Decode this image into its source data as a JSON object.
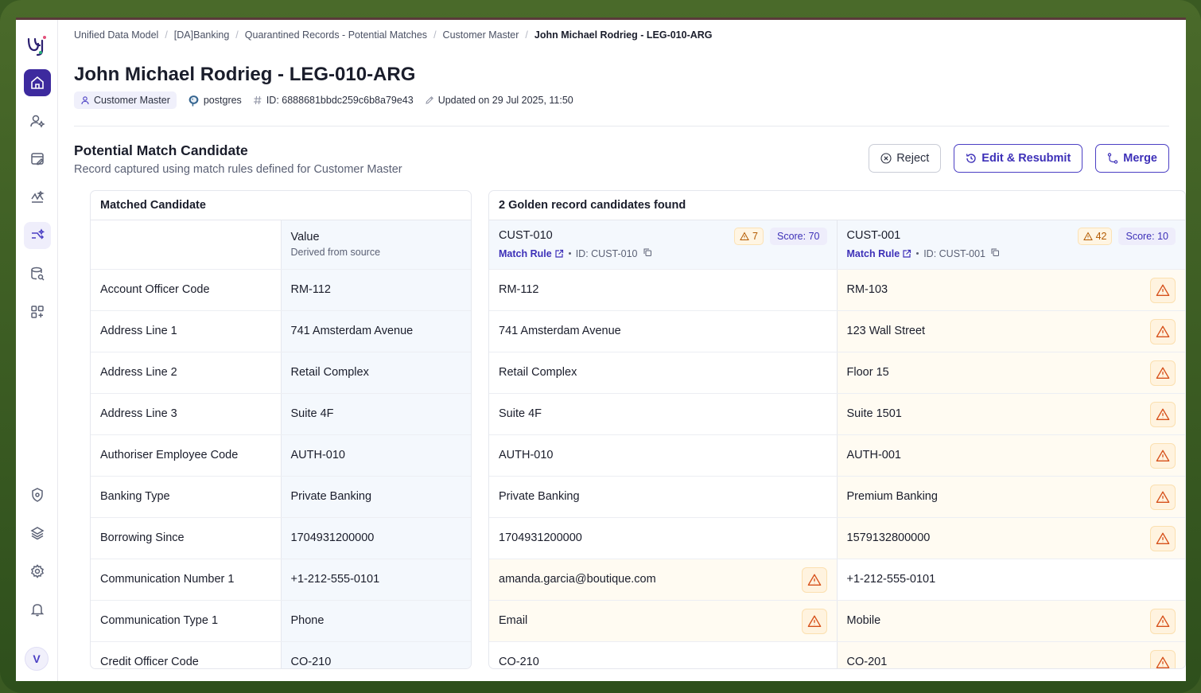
{
  "breadcrumb": [
    "Unified Data Model",
    "[DA]Banking",
    "Quarantined Records - Potential Matches",
    "Customer Master",
    "John Michael Rodrieg - LEG-010-ARG"
  ],
  "page_title": "John Michael Rodrieg - LEG-010-ARG",
  "meta": {
    "entity": "Customer Master",
    "source": "postgres",
    "id": "ID: 6888681bbdc259c6b8a79e43",
    "updated": "Updated on 29 Jul 2025, 11:50"
  },
  "section": {
    "title": "Potential Match Candidate",
    "subtitle": "Record captured using match rules defined for Customer Master"
  },
  "actions": {
    "reject": "Reject",
    "edit": "Edit & Resubmit",
    "merge": "Merge"
  },
  "left_panel": {
    "title": "Matched Candidate",
    "value_header": "Value",
    "value_sub": "Derived from source"
  },
  "right_panel": {
    "title": "2 Golden record candidates found",
    "match_rule_label": "Match Rule",
    "candidates": [
      {
        "id": "CUST-010",
        "ref": "ID: CUST-010",
        "warnings": "7",
        "score": "Score: 70"
      },
      {
        "id": "CUST-001",
        "ref": "ID: CUST-001",
        "warnings": "42",
        "score": "Score: 10"
      }
    ]
  },
  "rows": [
    {
      "field": "Account Officer Code",
      "value": "RM-112",
      "c1": "RM-112",
      "c1_warn": false,
      "c2": "RM-103",
      "c2_warn": true
    },
    {
      "field": "Address Line 1",
      "value": "741 Amsterdam Avenue",
      "c1": "741 Amsterdam Avenue",
      "c1_warn": false,
      "c2": "123 Wall Street",
      "c2_warn": true
    },
    {
      "field": "Address Line 2",
      "value": "Retail Complex",
      "c1": "Retail Complex",
      "c1_warn": false,
      "c2": "Floor 15",
      "c2_warn": true
    },
    {
      "field": "Address Line 3",
      "value": "Suite 4F",
      "c1": "Suite 4F",
      "c1_warn": false,
      "c2": "Suite 1501",
      "c2_warn": true
    },
    {
      "field": "Authoriser Employee Code",
      "value": "AUTH-010",
      "c1": "AUTH-010",
      "c1_warn": false,
      "c2": "AUTH-001",
      "c2_warn": true
    },
    {
      "field": "Banking Type",
      "value": "Private Banking",
      "c1": "Private Banking",
      "c1_warn": false,
      "c2": "Premium Banking",
      "c2_warn": true
    },
    {
      "field": "Borrowing Since",
      "value": "1704931200000",
      "c1": "1704931200000",
      "c1_warn": false,
      "c2": "1579132800000",
      "c2_warn": true
    },
    {
      "field": "Communication Number 1",
      "value": "+1-212-555-0101",
      "c1": "amanda.garcia@boutique.com",
      "c1_warn": true,
      "c2": "+1-212-555-0101",
      "c2_warn": false
    },
    {
      "field": "Communication Type 1",
      "value": "Phone",
      "c1": "Email",
      "c1_warn": true,
      "c2": "Mobile",
      "c2_warn": true
    },
    {
      "field": "Credit Officer Code",
      "value": "CO-210",
      "c1": "CO-210",
      "c1_warn": false,
      "c2": "CO-201",
      "c2_warn": true
    }
  ],
  "user": {
    "avatar_initial": "V"
  },
  "colors": {
    "accent": "#3d30b8",
    "warning": "#d6501a",
    "brand_home": "#3d2a9e"
  }
}
